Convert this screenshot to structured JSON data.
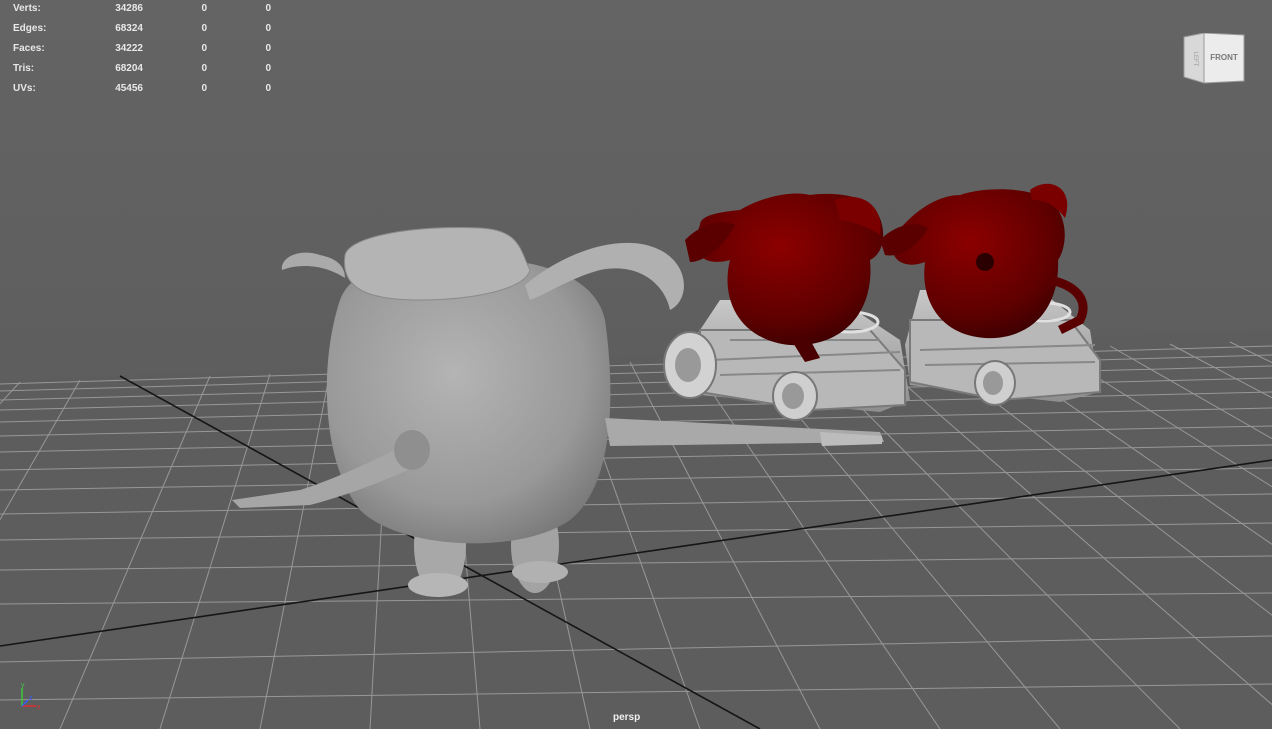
{
  "hud": {
    "rows": [
      {
        "label": "Verts:",
        "v1": "34286",
        "v2": "0",
        "v3": "0"
      },
      {
        "label": "Edges:",
        "v1": "68324",
        "v2": "0",
        "v3": "0"
      },
      {
        "label": "Faces:",
        "v1": "34222",
        "v2": "0",
        "v3": "0"
      },
      {
        "label": "Tris:",
        "v1": "68204",
        "v2": "0",
        "v3": "0"
      },
      {
        "label": "UVs:",
        "v1": "45456",
        "v2": "0",
        "v3": "0"
      }
    ]
  },
  "viewcube": {
    "front_label": "FRONT",
    "side_label": "LEFT"
  },
  "camera": {
    "name": "persp"
  },
  "axis": {
    "x": "x",
    "y": "y",
    "z": "z"
  },
  "colors": {
    "background": "#5f5f5f",
    "grid_line": "#a8a8a8",
    "grid_axis": "#111111",
    "model_grey": "#9a9a9a",
    "model_red": "#6e0000"
  }
}
